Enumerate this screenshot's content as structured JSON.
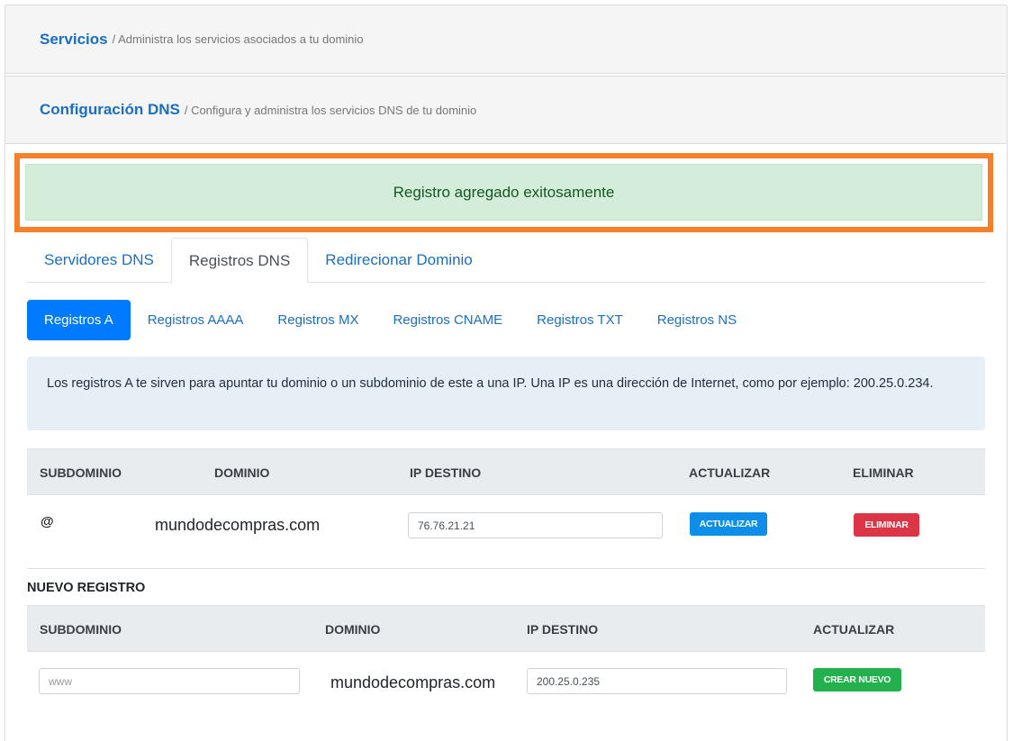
{
  "breadcrumbs": [
    {
      "title": "Servicios",
      "subtitle": "/ Administra los servicios asociados a tu dominio"
    },
    {
      "title": "Configuración DNS",
      "subtitle": "/ Configura y administra los servicios DNS de tu dominio"
    }
  ],
  "alert": {
    "message": "Registro agregado exitosamente"
  },
  "tabs": [
    {
      "label": "Servidores DNS"
    },
    {
      "label": "Registros DNS"
    },
    {
      "label": "Redirecionar Dominio"
    }
  ],
  "pills": [
    {
      "label": "Registros A"
    },
    {
      "label": "Registros AAAA"
    },
    {
      "label": "Registros MX"
    },
    {
      "label": "Registros CNAME"
    },
    {
      "label": "Registros TXT"
    },
    {
      "label": "Registros NS"
    }
  ],
  "info": {
    "text": "Los registros A te sirven para apuntar tu dominio o un subdominio de este a una IP. Una IP es una dirección de Internet, como por ejemplo: 200.25.0.234."
  },
  "records_table": {
    "headers": [
      "SUBDOMINIO",
      "DOMINIO",
      "IP DESTINO",
      "ACTUALIZAR",
      "ELIMINAR"
    ],
    "rows": [
      {
        "subdomain": "@",
        "domain": "mundodecompras.com",
        "ip": "76.76.21.21",
        "update_label": "ACTUALIZAR",
        "delete_label": "ELIMINAR"
      }
    ]
  },
  "new_record": {
    "title": "NUEVO REGISTRO",
    "headers": [
      "SUBDOMINIO",
      "DOMINIO",
      "IP DESTINO",
      "ACTUALIZAR"
    ],
    "subdomain_value": "www",
    "domain": "mundodecompras.com",
    "ip_value": "200.25.0.235",
    "create_label": "CREAR NUEVO"
  },
  "colors": {
    "accent": "#007bff",
    "link": "#1a6fc4",
    "success_bg": "#d4edda",
    "highlight": "#f77f2a",
    "danger": "#dc3545",
    "create": "#22b14c"
  }
}
